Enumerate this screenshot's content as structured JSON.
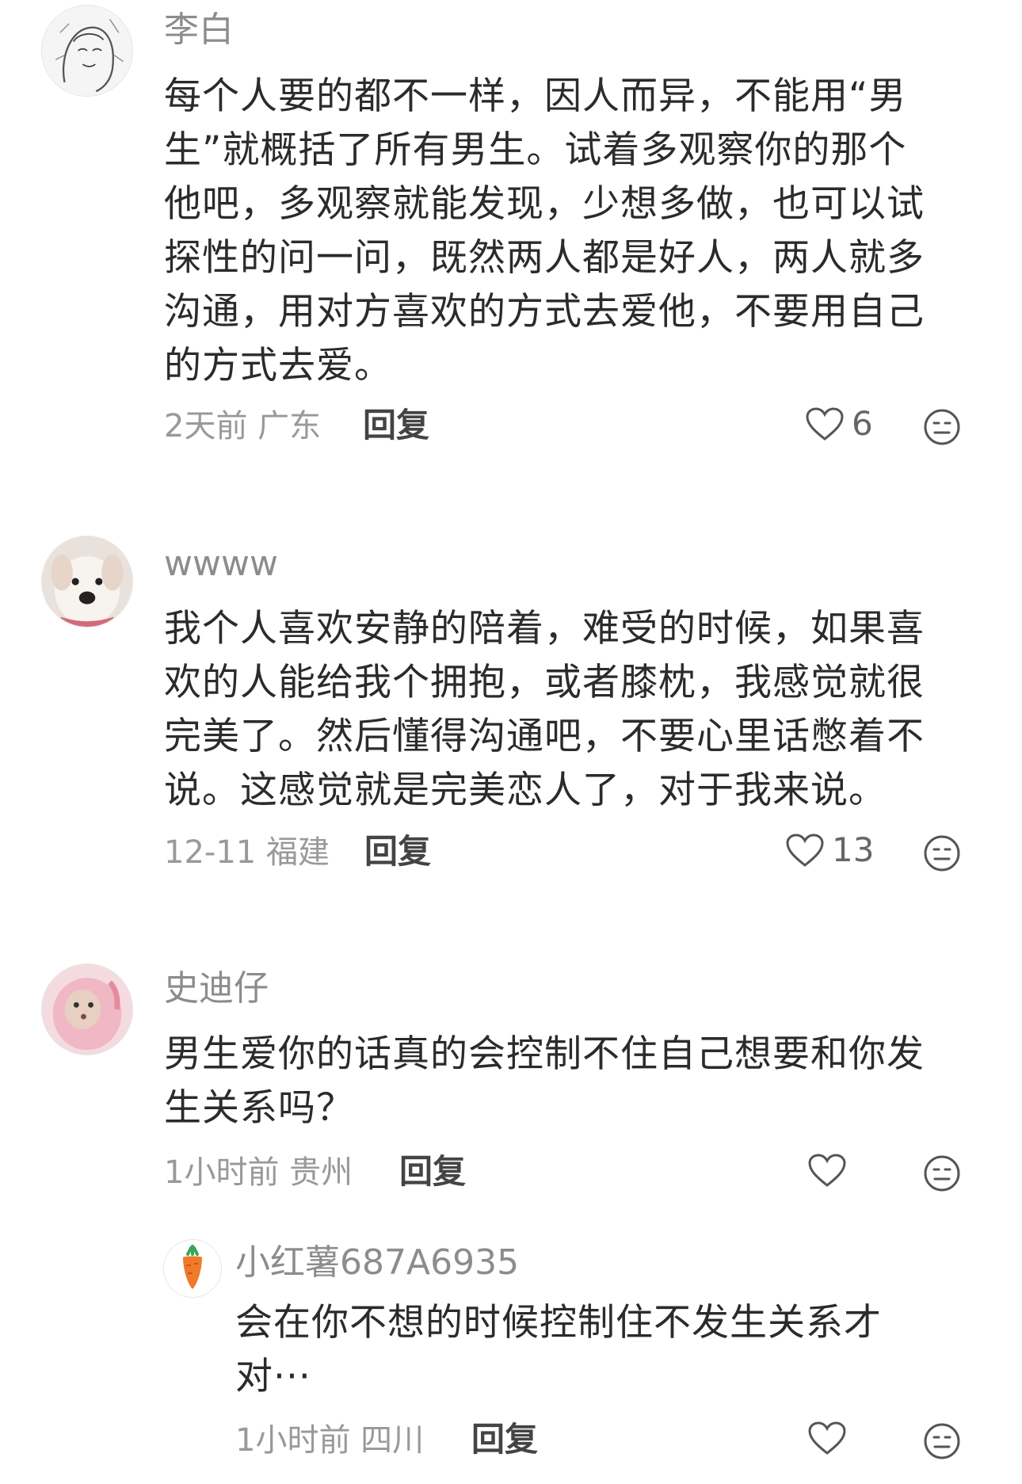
{
  "comments": [
    {
      "username": "李白",
      "lines": [
        "每个人要的都不一样，因人而异，不能用“男",
        "生”就概括了所有男生。试着多观察你的那个",
        "他吧，多观察就能发现，少想多做，也可以试",
        "探性的问一问，既然两人都是好人，两人就多",
        "沟通，用对方喜欢的方式去爱他，不要用自己",
        "的方式去爱。"
      ],
      "time_location": "2天前 广东",
      "reply_label": "回复",
      "likes": "6"
    },
    {
      "username": "wwww",
      "lines": [
        "我个人喜欢安静的陪着，难受的时候，如果喜",
        "欢的人能给我个拥抱，或者膝枕，我感觉就很",
        "完美了。然后懂得沟通吧，不要心里话憋着不",
        "说。这感觉就是完美恋人了，对于我来说。"
      ],
      "time_location": "12-11 福建",
      "reply_label": "回复",
      "likes": "13"
    },
    {
      "username": "史迪仔",
      "lines": [
        "男生爱你的话真的会控制不住自己想要和你发",
        "生关系吗？"
      ],
      "time_location": "1小时前 贵州",
      "reply_label": "回复",
      "likes": ""
    }
  ],
  "reply": {
    "username": "小红薯687A6935",
    "lines": [
      "会在你不想的时候控制住不发生关系才",
      "对···"
    ],
    "time_location": "1小时前 四川",
    "reply_label": "回复",
    "likes": ""
  },
  "icons": {
    "like": "heart-outline-icon",
    "dislike": "meh-face-icon"
  },
  "colors": {
    "text": "#2b2b2b",
    "muted": "#999999",
    "username": "#8c8c8c"
  }
}
